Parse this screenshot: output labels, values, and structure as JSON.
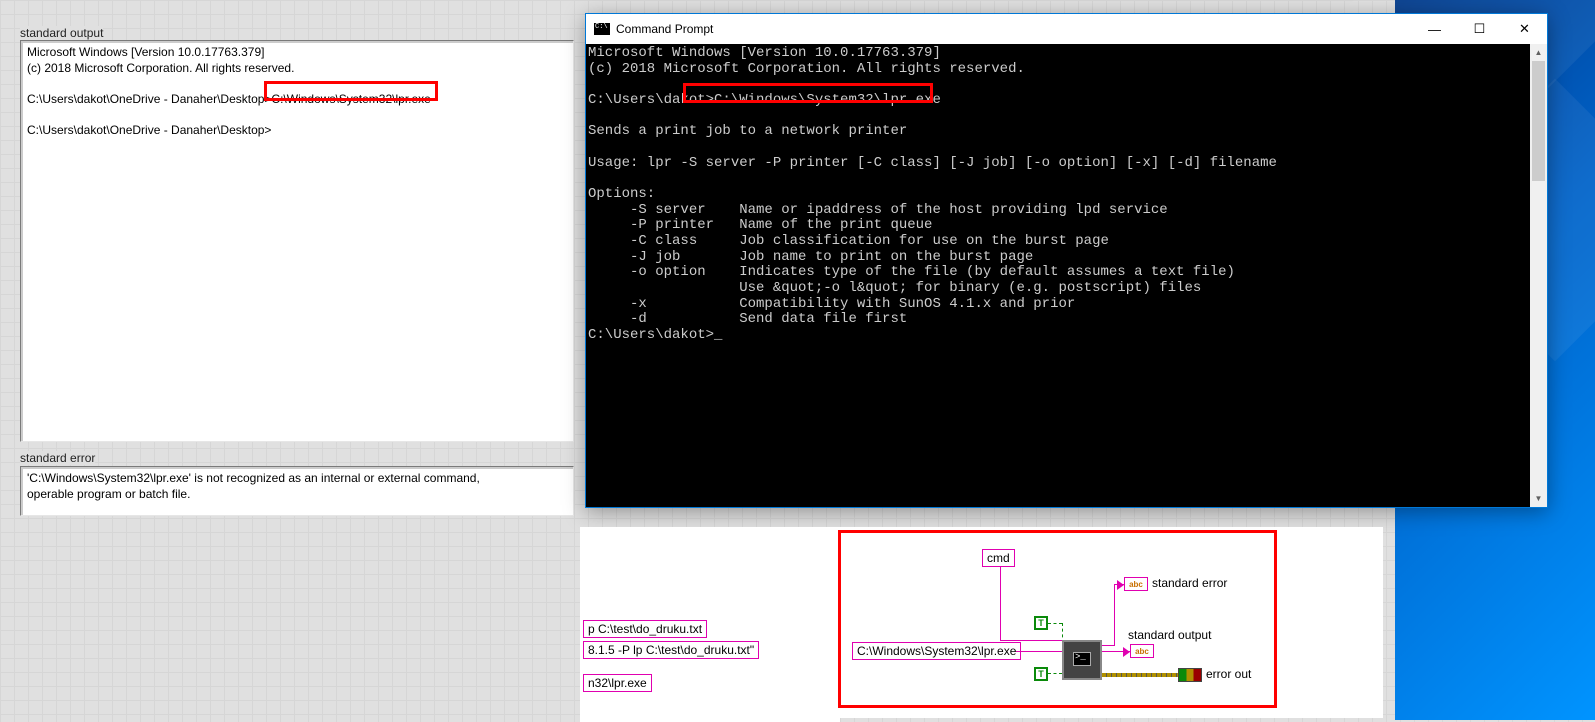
{
  "front_panel": {
    "stdout_label": "standard output",
    "stdout_text": "Microsoft Windows [Version 10.0.17763.379]\n(c) 2018 Microsoft Corporation. All rights reserved.\n\nC:\\Users\\dakot\\OneDrive - Danaher\\Desktop>C:\\Windows\\System32\\lpr.exe\n\nC:\\Users\\dakot\\OneDrive - Danaher\\Desktop>",
    "stderr_label": "standard error",
    "stderr_text": "'C:\\Windows\\System32\\lpr.exe' is not recognized as an internal or external command,\noperable program or batch file."
  },
  "cmd": {
    "title": "Command Prompt",
    "body": "Microsoft Windows [Version 10.0.17763.379]\n(c) 2018 Microsoft Corporation. All rights reserved.\n\nC:\\Users\\dakot>C:\\Windows\\System32\\lpr.exe\n\nSends a print job to a network printer\n\nUsage: lpr -S server -P printer [-C class] [-J job] [-o option] [-x] [-d] filename\n\nOptions:\n     -S server    Name or ipaddress of the host providing lpd service\n     -P printer   Name of the print queue\n     -C class     Job classification for use on the burst page\n     -J job       Job name to print on the burst page\n     -o option    Indicates type of the file (by default assumes a text file)\n                  Use &quot;-o l&quot; for binary (e.g. postscript) files\n     -x           Compatibility with SunOS 4.1.x and prior\n     -d           Send data file first\nC:\\Users\\dakot>_"
  },
  "block_diagram": {
    "cmd_label": "cmd",
    "const_path": "C:\\Windows\\System32\\lpr.exe",
    "standard_error": "standard error",
    "standard_output": "standard output",
    "error_out": "error out",
    "crop1": "p C:\\test\\do_druku.txt",
    "crop2": "8.1.5 -P lp C:\\test\\do_druku.txt\"",
    "crop3": "n32\\lpr.exe"
  }
}
